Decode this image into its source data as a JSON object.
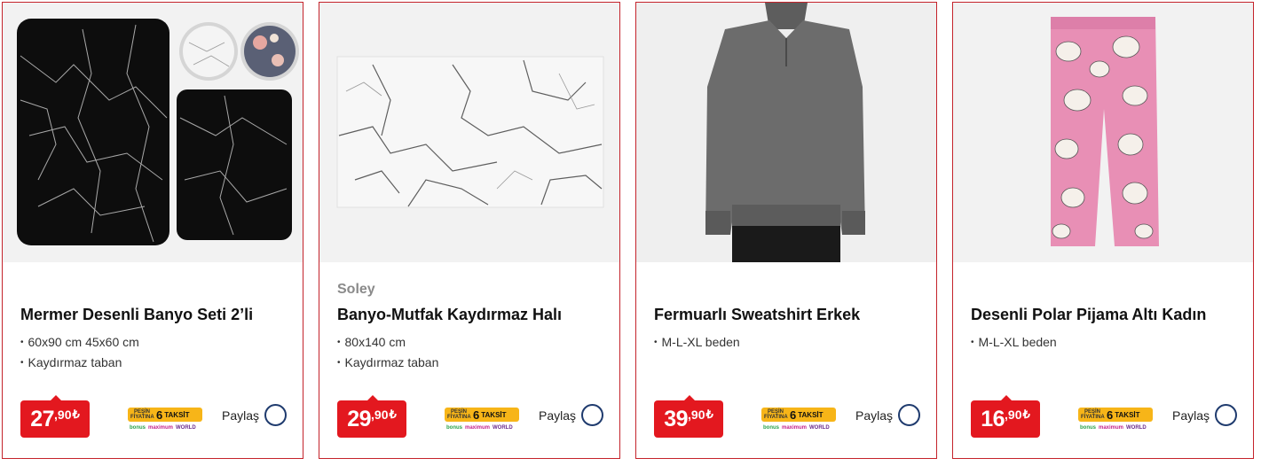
{
  "products": [
    {
      "brand": "",
      "title": "Mermer Desenli Banyo Seti 2’li",
      "features": [
        "60x90 cm 45x60 cm",
        "Kaydırmaz taban"
      ],
      "price_int": "27",
      "price_dec": ",90",
      "currency": "₺",
      "image": "black-marble-bath-mat-set"
    },
    {
      "brand": "Soley",
      "title": "Banyo-Mutfak Kaydırmaz Halı",
      "features": [
        "80x140 cm",
        "Kaydırmaz taban"
      ],
      "price_int": "29",
      "price_dec": ",90",
      "currency": "₺",
      "image": "white-marble-rug"
    },
    {
      "brand": "",
      "title": "Fermuarlı Sweatshirt Erkek",
      "features": [
        "M-L-XL beden"
      ],
      "price_int": "39",
      "price_dec": ",90",
      "currency": "₺",
      "image": "gray-zip-sweatshirt"
    },
    {
      "brand": "",
      "title": "Desenli Polar Pijama Altı Kadın",
      "features": [
        "M-L-XL beden"
      ],
      "price_int": "16",
      "price_dec": ",90",
      "currency": "₺",
      "image": "pink-pug-pajama-pants"
    }
  ],
  "installment": {
    "pesin": "PEŞİN FİYATINA",
    "count": "6",
    "label": "TAKSİT",
    "brands": [
      "bonus",
      "maximum",
      "WORLD"
    ]
  },
  "share_label": "Paylaş",
  "colors": {
    "accent": "#e3181f",
    "border": "#c4232b",
    "taksit_yellow": "#f7b518",
    "share_circle": "#1f3b6e"
  }
}
